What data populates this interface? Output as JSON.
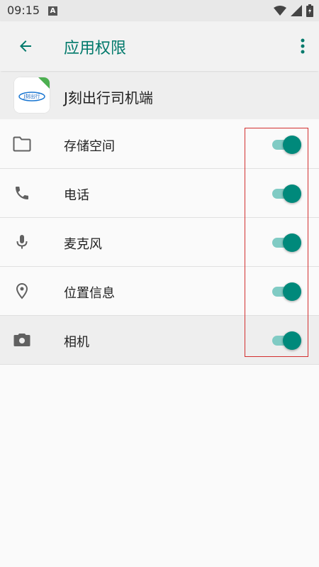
{
  "status_bar": {
    "time": "09:15",
    "notification_glyph": "A"
  },
  "app_bar": {
    "title": "应用权限",
    "back_icon": "arrow-back-icon",
    "more_icon": "more-vert-icon"
  },
  "app": {
    "name": "J刻出行司机端",
    "logo_text": "J刻出行"
  },
  "permissions": [
    {
      "label": "存储空间",
      "icon": "folder-icon",
      "enabled": true
    },
    {
      "label": "电话",
      "icon": "phone-icon",
      "enabled": true
    },
    {
      "label": "麦克风",
      "icon": "microphone-icon",
      "enabled": true
    },
    {
      "label": "位置信息",
      "icon": "location-icon",
      "enabled": true
    },
    {
      "label": "相机",
      "icon": "camera-icon",
      "enabled": true
    }
  ],
  "colors": {
    "accent": "#00796b",
    "toggle_thumb": "#00897b",
    "toggle_track": "#80cbc4",
    "highlight_frame": "#d32f2f"
  }
}
